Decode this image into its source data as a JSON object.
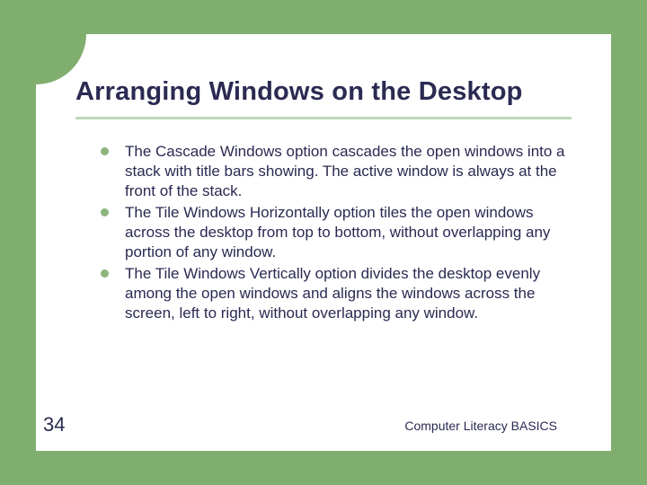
{
  "slide": {
    "title": "Arranging Windows on the Desktop",
    "bullets": [
      "The Cascade Windows option cascades the open windows into a stack with title bars showing. The active window is always at the front of the stack.",
      "The Tile Windows Horizontally option tiles the open windows across the desktop from top to bottom, without overlapping any portion of any window.",
      "The Tile Windows Vertically option divides the desktop evenly among the open windows and aligns the windows across the screen, left to right, without overlapping any window."
    ],
    "page_number": "34",
    "footer": "Computer Literacy BASICS"
  }
}
